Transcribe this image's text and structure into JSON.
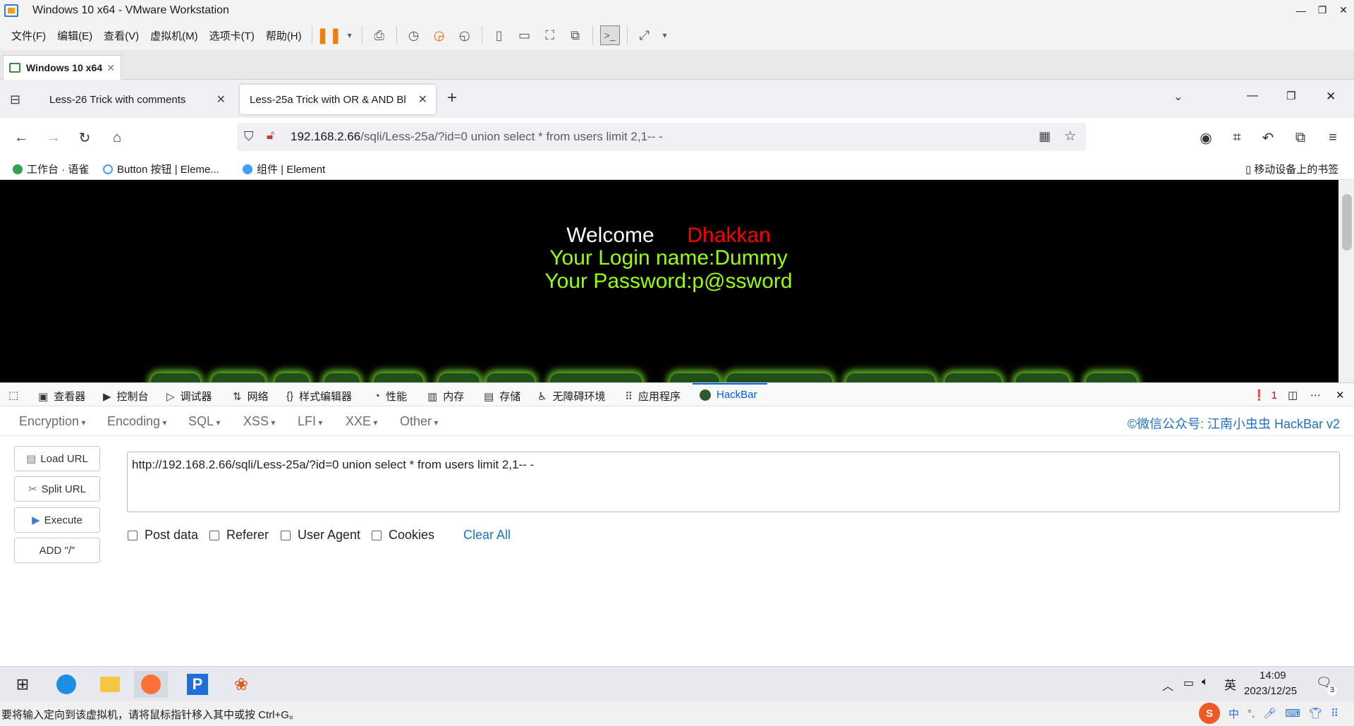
{
  "vm": {
    "title": "Windows 10 x64 - VMware Workstation",
    "menu": [
      "文件(F)",
      "编辑(E)",
      "查看(V)",
      "虚拟机(M)",
      "选项卡(T)",
      "帮助(H)"
    ],
    "tab": "Windows 10 x64",
    "status": "要将输入定向到该虚拟机，请将鼠标指针移入其中或按 Ctrl+G。"
  },
  "browser": {
    "tabs": [
      {
        "label": "Less-26 Trick with comments"
      },
      {
        "label": "Less-25a Trick with OR & AND Bl"
      }
    ],
    "url_host": "192.168.2.66",
    "url_path": "/sqli/Less-25a/?id=0 union select * from users limit 2,1-- -",
    "bookmarks": [
      "工作台 · 语雀",
      "Button 按钮 | Eleme...",
      "组件 | Element"
    ],
    "mobile_bookmarks": "移动设备上的书签"
  },
  "page": {
    "welcome": "Welcome",
    "user": "Dhakkan",
    "login_name": "Your Login name:Dummy",
    "password": "Your Password:p@ssword"
  },
  "devtools": {
    "tabs": [
      "查看器",
      "控制台",
      "调试器",
      "网络",
      "样式编辑器",
      "性能",
      "内存",
      "存储",
      "无障碍环境",
      "应用程序",
      "HackBar"
    ],
    "error_count": "1"
  },
  "hackbar": {
    "menus": [
      "Encryption",
      "Encoding",
      "SQL",
      "XSS",
      "LFI",
      "XXE",
      "Other"
    ],
    "brand": "©微信公众号: 江南小虫虫 HackBar v2",
    "buttons": [
      "Load URL",
      "Split URL",
      "Execute",
      "ADD \"/\""
    ],
    "url": "http://192.168.2.66/sqli/Less-25a/?id=0 union select * from users limit 2,1-- -",
    "options": [
      "Post data",
      "Referer",
      "User Agent",
      "Cookies"
    ],
    "clear_all": "Clear All"
  },
  "taskbar": {
    "time": "14:09",
    "date": "2023/12/25",
    "ime": "英",
    "notification_count": "3"
  },
  "colors": {
    "welcome": "#ffffff",
    "user": "#ff0000",
    "info": "#99ff00",
    "link": "#1e72c8"
  }
}
